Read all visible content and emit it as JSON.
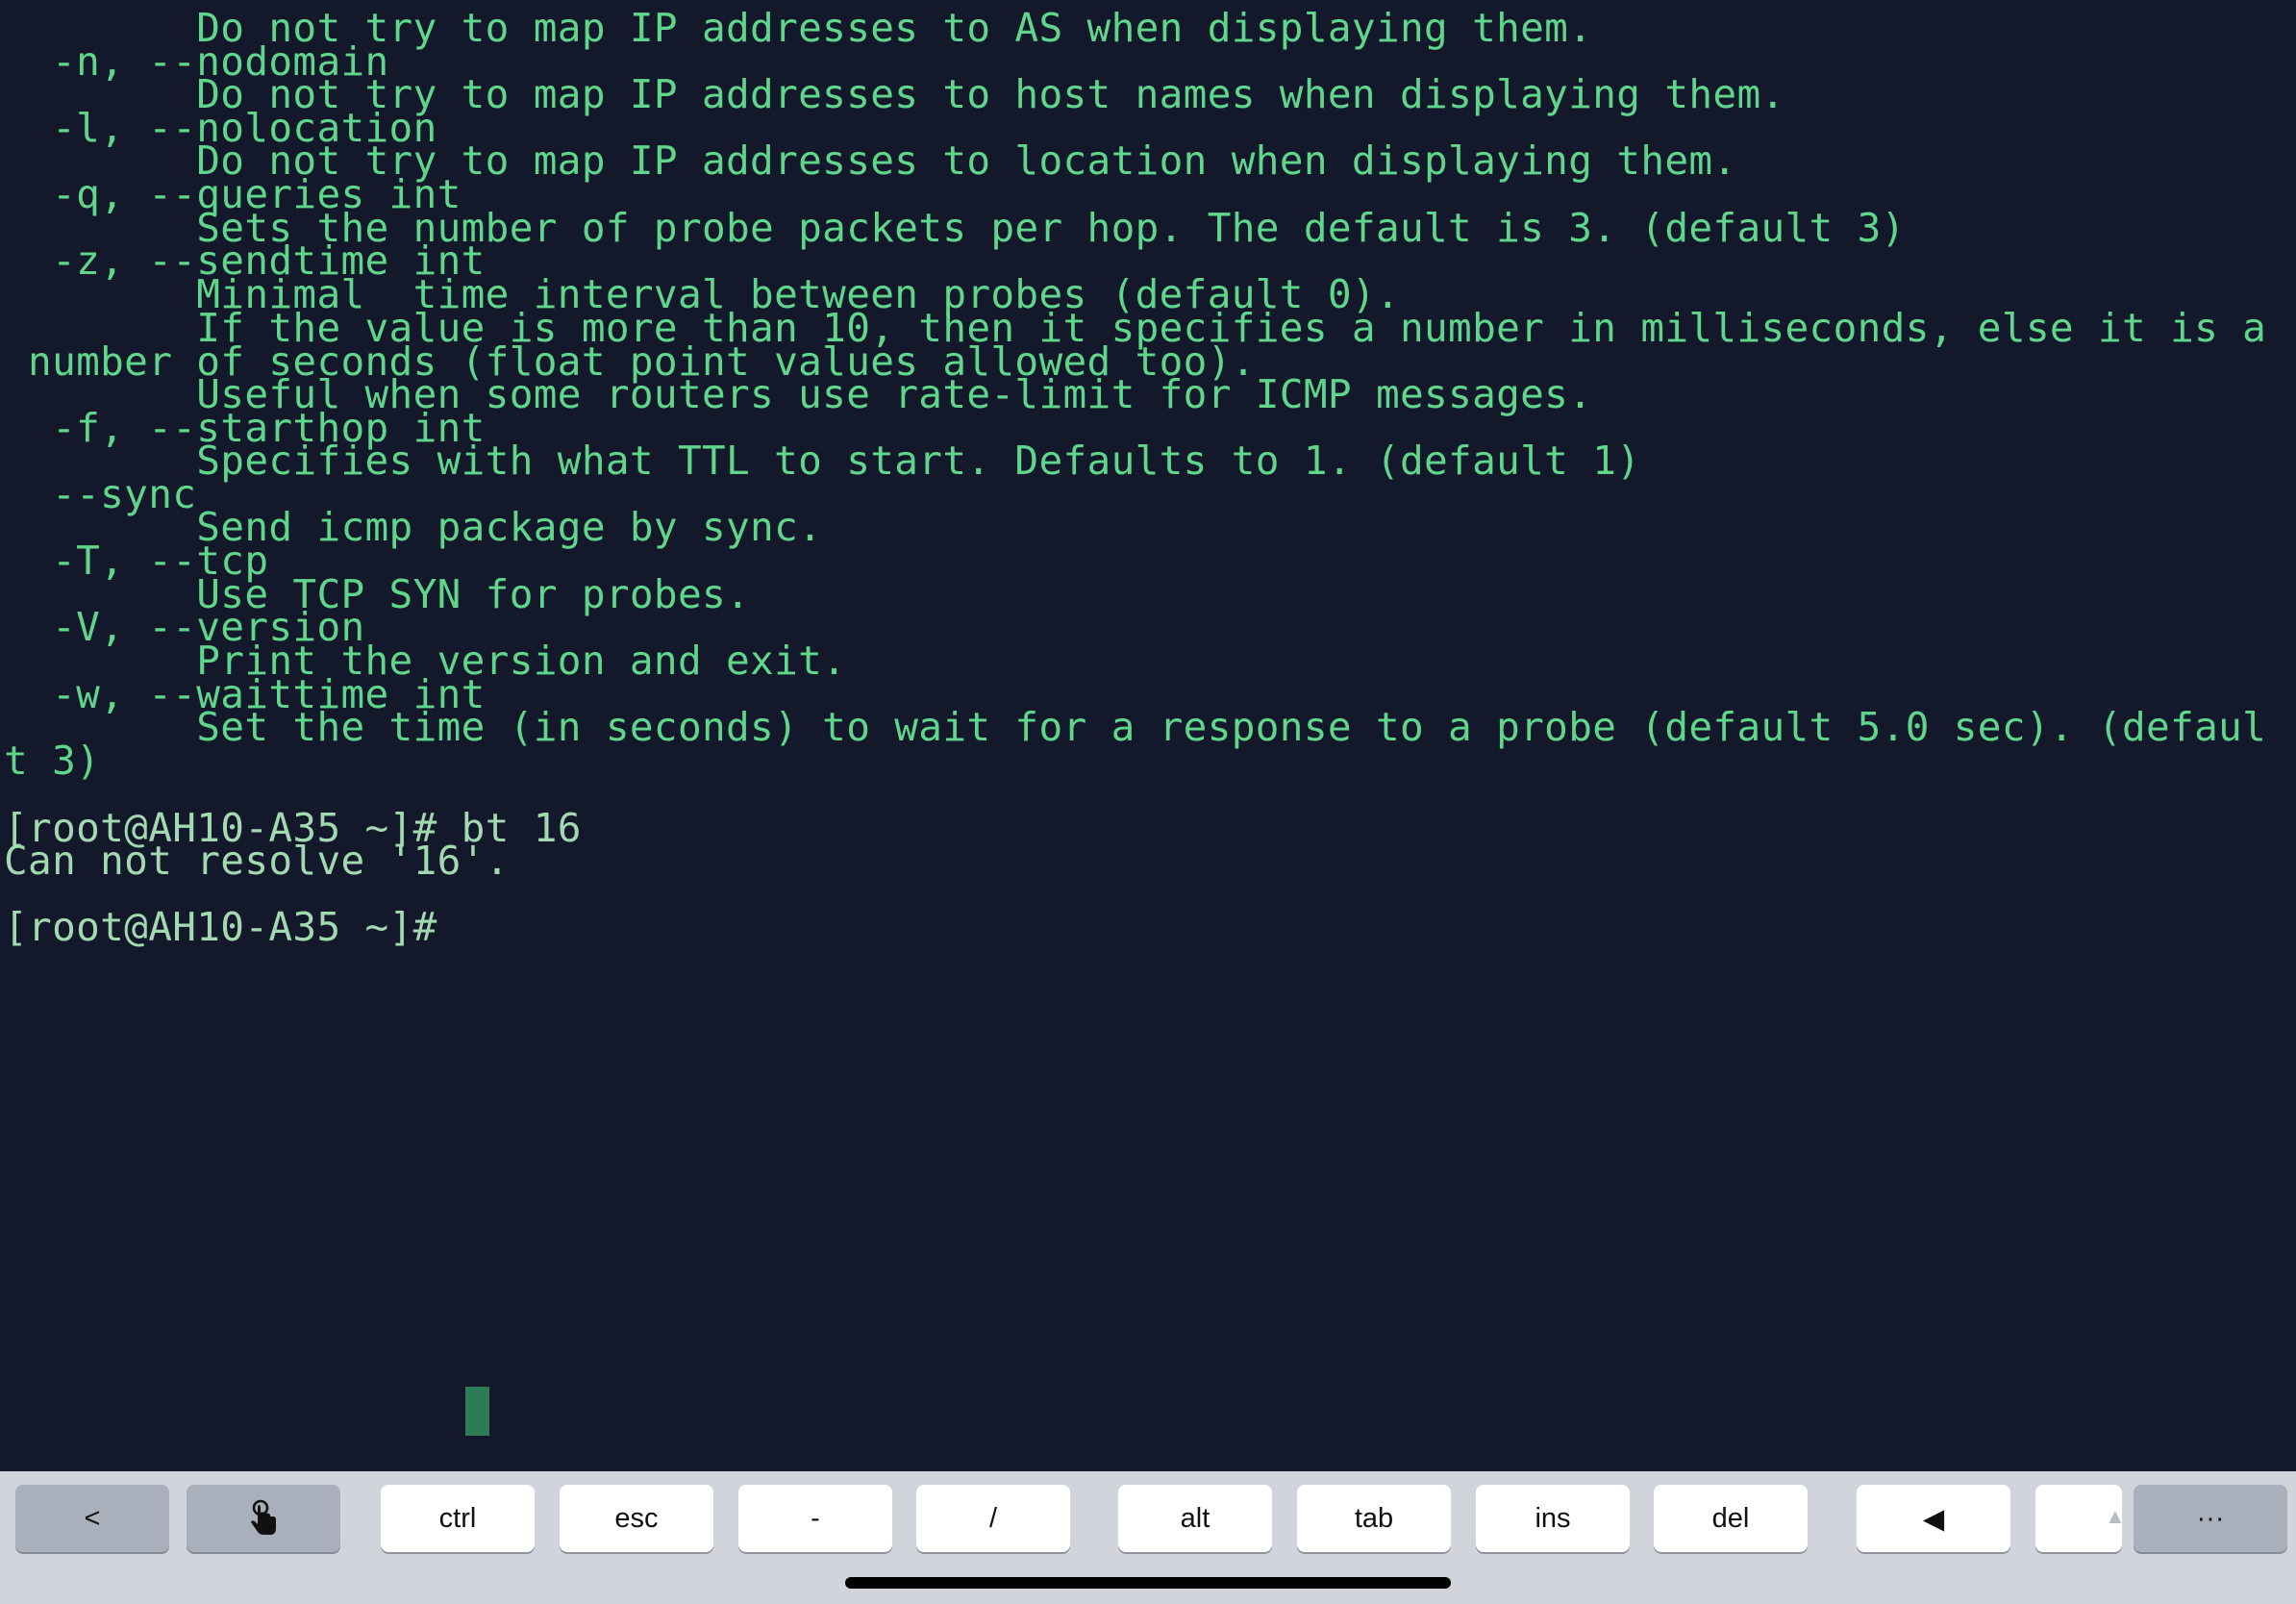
{
  "terminal": {
    "lines": [
      "        Do not try to map IP addresses to AS when displaying them.",
      "  -n, --nodomain",
      "        Do not try to map IP addresses to host names when displaying them.",
      "  -l, --nolocation",
      "        Do not try to map IP addresses to location when displaying them.",
      "  -q, --queries int",
      "        Sets the number of probe packets per hop. The default is 3. (default 3)",
      "  -z, --sendtime int",
      "        Minimal  time interval between probes (default 0).",
      "        If the value is more than 10, then it specifies a number in milliseconds, else it is a",
      " number of seconds (float point values allowed too).",
      "        Useful when some routers use rate-limit for ICMP messages.",
      "  -f, --starthop int",
      "        Specifies with what TTL to start. Defaults to 1. (default 1)",
      "  --sync",
      "        Send icmp package by sync.",
      "  -T, --tcp",
      "        Use TCP SYN for probes.",
      "  -V, --version",
      "        Print the version and exit.",
      "  -w, --waittime int",
      "        Set the time (in seconds) to wait for a response to a probe (default 5.0 sec). (defaul",
      "t 3)",
      "",
      "[root@AH10-A35 ~]# bt 16",
      "Can not resolve '16'.",
      "",
      "[root@AH10-A35 ~]# "
    ]
  },
  "keyboard_bar": {
    "keys": {
      "back": "<",
      "touch": "touch-icon",
      "ctrl": "ctrl",
      "esc": "esc",
      "dash": "-",
      "slash": "/",
      "alt": "alt",
      "tab": "tab",
      "ins": "ins",
      "del": "del",
      "left_arrow": "◀",
      "partial": "▲",
      "more": "···"
    }
  },
  "colors": {
    "terminal_background": "#14182b",
    "terminal_text": "#5fd68b",
    "prompt_text": "#a3d9b1",
    "cursor": "#2e7b57",
    "key_bar_background": "#d1d4db"
  }
}
